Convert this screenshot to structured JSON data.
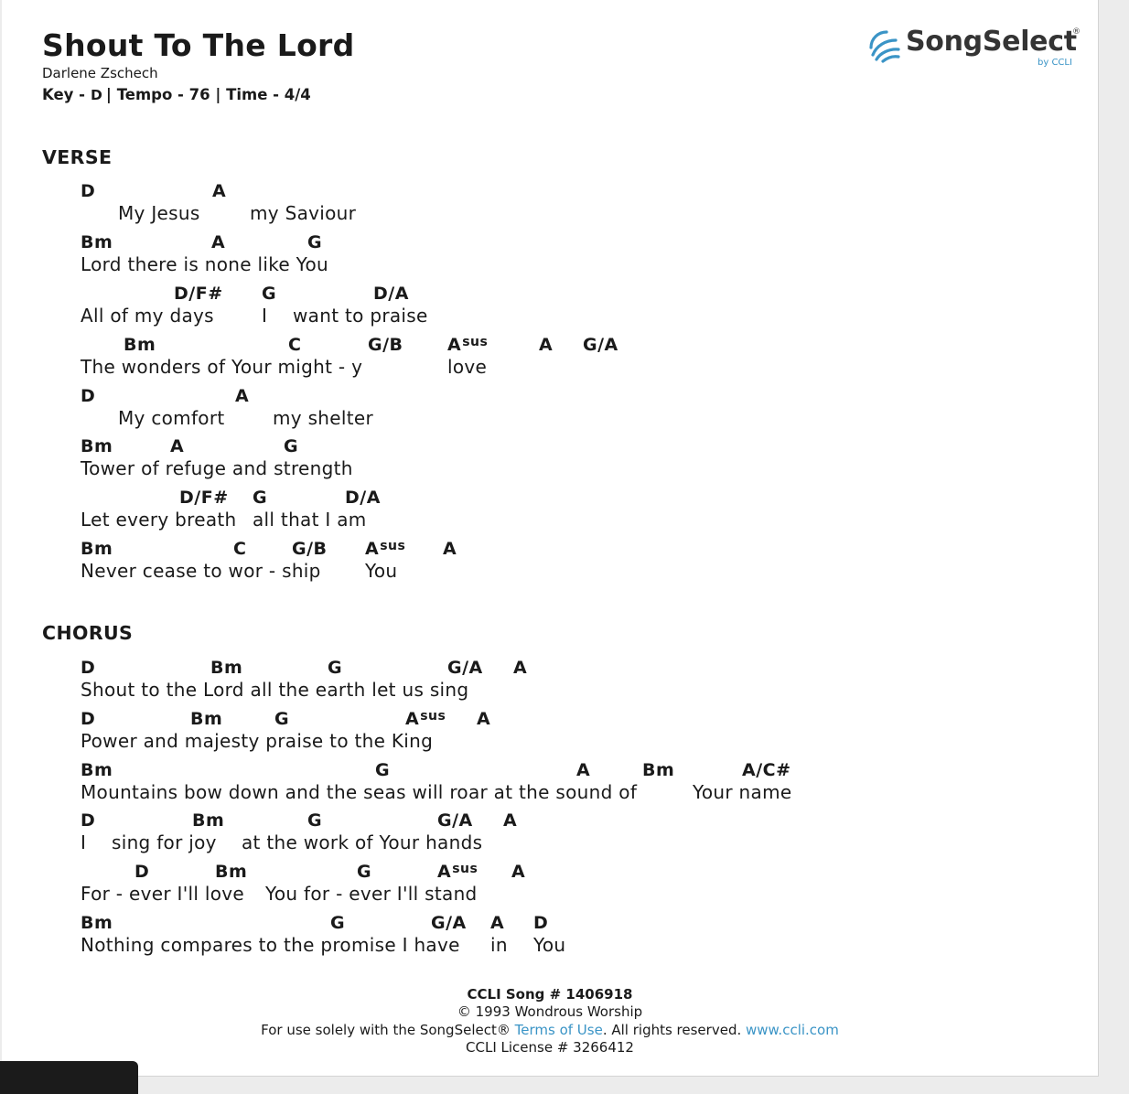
{
  "song": {
    "title": "Shout To The Lord",
    "author": "Darlene Zschech",
    "key_label": "Key -",
    "key": "D",
    "tempo_time": "| Tempo - 76 | Time - 4/4"
  },
  "logo": {
    "text": "SongSelect",
    "registered": "®",
    "by": "by CCLI",
    "icon": "songselect-waves-icon",
    "color": "#3a94c6"
  },
  "sections": [
    {
      "label": "VERSE",
      "lines": [
        {
          "chords": [
            {
              "t": "D"
            },
            {
              "t": "A"
            }
          ],
          "lyrics": [
            {
              "t": "My Jesus"
            },
            {
              "t": "my Saviour"
            }
          ]
        },
        {
          "chords": [
            {
              "t": "Bm"
            },
            {
              "t": "A"
            },
            {
              "t": "G"
            }
          ],
          "lyrics": [
            {
              "t": "Lord there is none like You"
            }
          ]
        },
        {
          "chords": [
            {
              "t": "D/F#"
            },
            {
              "t": "G"
            },
            {
              "t": "D/A"
            }
          ],
          "lyrics": [
            {
              "t": "All of my days"
            },
            {
              "t": "I"
            },
            {
              "t": "want to praise"
            }
          ]
        },
        {
          "chords": [
            {
              "t": "Bm"
            },
            {
              "t": "C"
            },
            {
              "t": "G/B"
            },
            {
              "t": "A",
              "sup": "sus"
            },
            {
              "t": "A"
            },
            {
              "t": "G/A"
            }
          ],
          "lyrics": [
            {
              "t": "The wonders of Your might - y"
            },
            {
              "t": "love"
            }
          ]
        },
        {
          "chords": [
            {
              "t": "D"
            },
            {
              "t": "A"
            }
          ],
          "lyrics": [
            {
              "t": "My comfort"
            },
            {
              "t": "my shelter"
            }
          ]
        },
        {
          "chords": [
            {
              "t": "Bm"
            },
            {
              "t": "A"
            },
            {
              "t": "G"
            }
          ],
          "lyrics": [
            {
              "t": "Tower of refuge and strength"
            }
          ]
        },
        {
          "chords": [
            {
              "t": "D/F#"
            },
            {
              "t": "G"
            },
            {
              "t": "D/A"
            }
          ],
          "lyrics": [
            {
              "t": "Let every breath"
            },
            {
              "t": "all that I am"
            }
          ]
        },
        {
          "chords": [
            {
              "t": "Bm"
            },
            {
              "t": "C"
            },
            {
              "t": "G/B"
            },
            {
              "t": "A",
              "sup": "sus"
            },
            {
              "t": "A"
            }
          ],
          "lyrics": [
            {
              "t": "Never cease to wor - ship"
            },
            {
              "t": "You"
            }
          ]
        }
      ]
    },
    {
      "label": "CHORUS",
      "lines": [
        {
          "chords": [
            {
              "t": "D"
            },
            {
              "t": "Bm"
            },
            {
              "t": "G"
            },
            {
              "t": "G/A"
            },
            {
              "t": "A"
            }
          ],
          "lyrics": [
            {
              "t": "Shout to the Lord all the earth let us sing"
            }
          ]
        },
        {
          "chords": [
            {
              "t": "D"
            },
            {
              "t": "Bm"
            },
            {
              "t": "G"
            },
            {
              "t": "A",
              "sup": "sus"
            },
            {
              "t": "A"
            }
          ],
          "lyrics": [
            {
              "t": "Power and majesty praise to the King"
            }
          ]
        },
        {
          "chords": [
            {
              "t": "Bm"
            },
            {
              "t": "G"
            },
            {
              "t": "A"
            },
            {
              "t": "Bm"
            },
            {
              "t": "A/C#"
            }
          ],
          "lyrics": [
            {
              "t": "Mountains bow down and the seas will roar at the sound of"
            },
            {
              "t": "Your name"
            }
          ]
        },
        {
          "chords": [
            {
              "t": "D"
            },
            {
              "t": "Bm"
            },
            {
              "t": "G"
            },
            {
              "t": "G/A"
            },
            {
              "t": "A"
            }
          ],
          "lyrics": [
            {
              "t": "I"
            },
            {
              "t": "sing for joy"
            },
            {
              "t": "at the work of Your hands"
            }
          ]
        },
        {
          "chords": [
            {
              "t": "D"
            },
            {
              "t": "Bm"
            },
            {
              "t": "G"
            },
            {
              "t": "A",
              "sup": "sus"
            },
            {
              "t": "A"
            }
          ],
          "lyrics": [
            {
              "t": "For - ever I'll love"
            },
            {
              "t": "You for - ever I'll stand"
            }
          ]
        },
        {
          "chords": [
            {
              "t": "Bm"
            },
            {
              "t": "G"
            },
            {
              "t": "G/A"
            },
            {
              "t": "A"
            },
            {
              "t": "D"
            }
          ],
          "lyrics": [
            {
              "t": "Nothing compares to the promise I have"
            },
            {
              "t": "in"
            },
            {
              "t": "You"
            }
          ]
        }
      ]
    }
  ],
  "footer": {
    "song_number": "CCLI Song # 1406918",
    "copyright": "© 1993 Wondrous Worship",
    "usage_prefix": "For use solely with the SongSelect® ",
    "terms_link": "Terms of Use",
    "usage_middle": ". All rights reserved. ",
    "site_link": "www.ccli.com",
    "license": "CCLI License # 3266412"
  }
}
